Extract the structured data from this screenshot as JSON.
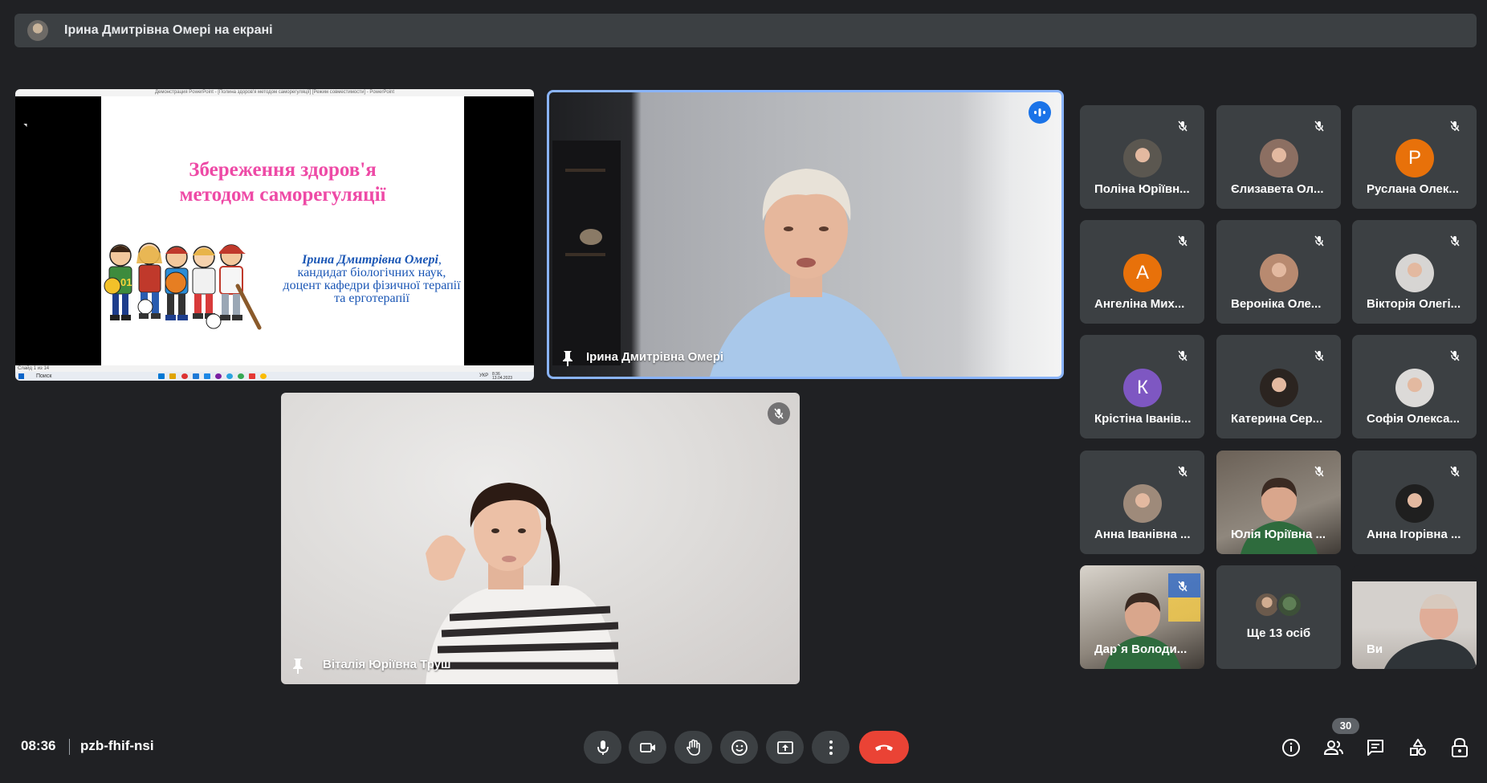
{
  "banner": {
    "text": "Ірина Дмитрівна Омері на екрані"
  },
  "presentation": {
    "window_title": "Демонстрация PowerPoint - [Полина здоров'я методом саморегуляції] [Режим совместимости] - PowerPoint",
    "slide_title_line1": "Збереження  здоров'я",
    "slide_title_line2": "методом саморегуляції",
    "author_name": "Ірина Дмитрівна Омері",
    "author_desc": "кандидат біологічних наук, доцент кафедри фізичної терапії та ерготерапії",
    "slide_counter": "Слайд 1 из 14",
    "taskbar_search": "Поиск",
    "taskbar_lang": "УКР",
    "taskbar_date": "13.04.2023",
    "taskbar_time": "8:36"
  },
  "speaker": {
    "name": "Ірина Дмитрівна Омері"
  },
  "second_video": {
    "name": "Віталія Юріївна Труш"
  },
  "grid": [
    {
      "name": "Поліна Юріївн...",
      "avatar": "photo",
      "color": "#5b5750"
    },
    {
      "name": "Єлизавета Ол...",
      "avatar": "photo",
      "color": "#8c6f62"
    },
    {
      "name": "Руслана Олек...",
      "avatar": "Р",
      "color": "#e8710a"
    },
    {
      "name": "Ангеліна Мих...",
      "avatar": "А",
      "color": "#e8710a"
    },
    {
      "name": "Вероніка Оле...",
      "avatar": "photo",
      "color": "#b88a70"
    },
    {
      "name": "Вікторія Олегі...",
      "avatar": "photo",
      "color": "#d7d5d3"
    },
    {
      "name": "Крістіна Іванів...",
      "avatar": "К",
      "color": "#7e57c2"
    },
    {
      "name": "Катерина Сер...",
      "avatar": "photo",
      "color": "#2b2420"
    },
    {
      "name": "Софія Олекса...",
      "avatar": "photo",
      "color": "#dcdad8"
    },
    {
      "name": "Анна Іванівна ...",
      "avatar": "photo",
      "color": "#9e8a7a"
    },
    {
      "name": "Юлія Юріївна ...",
      "avatar": "video",
      "color": "#6b6157"
    },
    {
      "name": "Анна Ігорівна ...",
      "avatar": "photo",
      "color": "#1f1f1f"
    },
    {
      "name": "Дар`я Володи...",
      "avatar": "video",
      "color": "#d9d4cc"
    },
    {
      "name": "Ще 13 осіб",
      "avatar": "group",
      "color": "#3c4043"
    },
    {
      "name": "Ви",
      "avatar": "video",
      "color": "#c9c4be"
    }
  ],
  "bottom_bar": {
    "time": "08:36",
    "meeting_code": "pzb-fhif-nsi",
    "participants_count": "30"
  },
  "icons": {
    "mic": "mic-icon",
    "camera": "camera-icon",
    "hand": "raise-hand-icon",
    "emoji": "emoji-icon",
    "present": "present-icon",
    "more": "more-icon",
    "end": "end-call-icon",
    "info": "info-icon",
    "people": "people-icon",
    "chat": "chat-icon",
    "activities": "activities-icon",
    "host": "host-controls-icon"
  },
  "colors": {
    "accent": "#8ab4f8",
    "end_call": "#ea4335",
    "speaking": "#1a73e8",
    "background": "#202124",
    "tile": "#3c4043"
  }
}
